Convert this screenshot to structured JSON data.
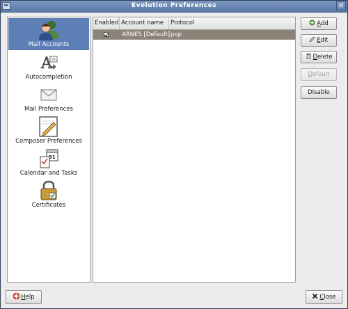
{
  "window": {
    "title": "Evolution Preferences"
  },
  "sidebar": {
    "items": [
      {
        "label": "Mail Accounts",
        "icon": "mail-accounts-icon",
        "selected": true
      },
      {
        "label": "Autocompletion",
        "icon": "autocompletion-icon",
        "selected": false
      },
      {
        "label": "Mail Preferences",
        "icon": "envelope-icon",
        "selected": false
      },
      {
        "label": "Composer Preferences",
        "icon": "composer-icon",
        "selected": false
      },
      {
        "label": "Calendar and Tasks",
        "icon": "calendar-icon",
        "selected": false
      },
      {
        "label": "Certificates",
        "icon": "padlock-icon",
        "selected": false
      }
    ],
    "calendar_day": "31"
  },
  "accounts": {
    "columns": [
      "Enabled",
      "Account name",
      "Protocol"
    ],
    "rows": [
      {
        "enabled": true,
        "name": "ARNES [Default]",
        "protocol": "pop"
      }
    ]
  },
  "buttons": {
    "add": {
      "prefix": "",
      "mnemonic": "A",
      "rest": "dd"
    },
    "edit": {
      "prefix": "",
      "mnemonic": "E",
      "rest": "dit"
    },
    "delete": {
      "prefix": "",
      "mnemonic": "D",
      "rest": "elete"
    },
    "default": {
      "prefix": "",
      "mnemonic": "D",
      "rest": "efault"
    },
    "disable": {
      "label": "Disable"
    },
    "help": {
      "mnemonic": "H",
      "rest": "elp"
    },
    "close": {
      "mnemonic": "C",
      "rest": "lose"
    }
  },
  "colors": {
    "selection": "#5c7fb5",
    "row_selected": "#8b8378",
    "titlebar": "#6b89b6"
  }
}
